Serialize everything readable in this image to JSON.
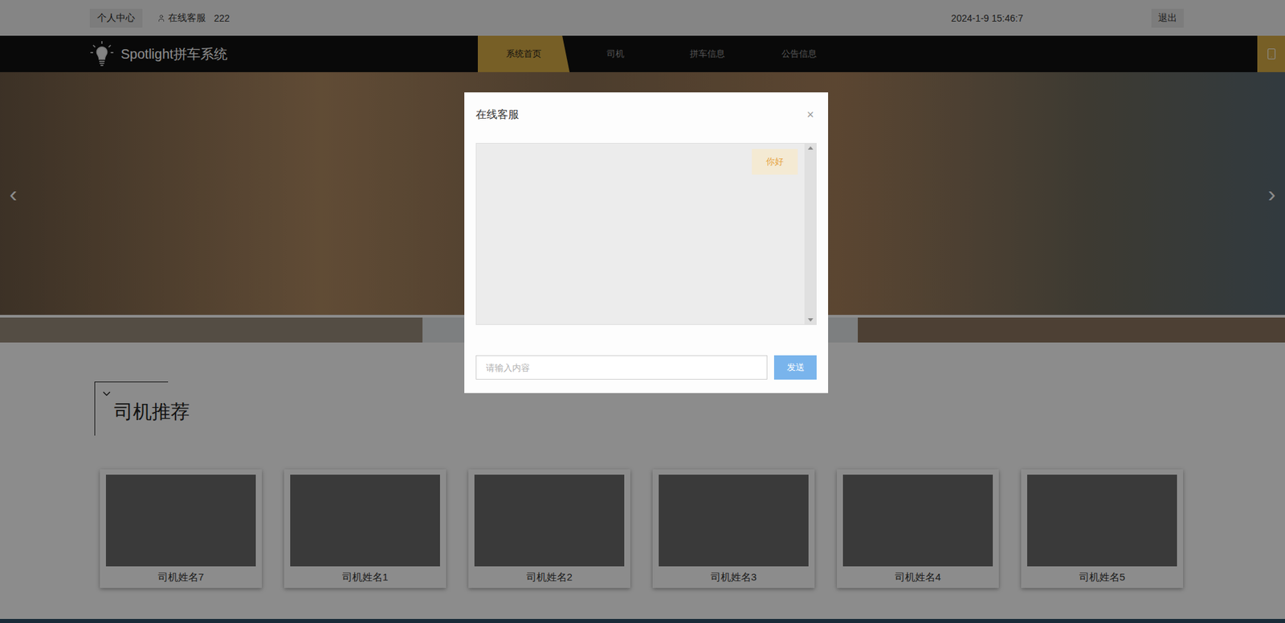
{
  "topbar": {
    "profile": "个人中心",
    "service": "在线客服",
    "username": "222",
    "datetime": "2024-1-9 15:46:7",
    "logout": "退出"
  },
  "brand": {
    "title": "Spotlight拼车系统"
  },
  "nav": [
    {
      "label": "系统首页",
      "selected": true
    },
    {
      "label": "司机",
      "selected": false
    },
    {
      "label": "拼车信息",
      "selected": false
    },
    {
      "label": "公告信息",
      "selected": false
    }
  ],
  "banner": {
    "prev": "‹",
    "next": "›"
  },
  "section": {
    "title": "司机推荐"
  },
  "drivers": [
    {
      "name": "司机姓名7"
    },
    {
      "name": "司机姓名1"
    },
    {
      "name": "司机姓名2"
    },
    {
      "name": "司机姓名3"
    },
    {
      "name": "司机姓名4"
    },
    {
      "name": "司机姓名5"
    }
  ],
  "chat": {
    "title": "在线客服",
    "close": "×",
    "messages": [
      {
        "text": "你好",
        "from": "user"
      }
    ],
    "input": {
      "placeholder": "请输入内容",
      "value": ""
    },
    "send": "发送"
  }
}
